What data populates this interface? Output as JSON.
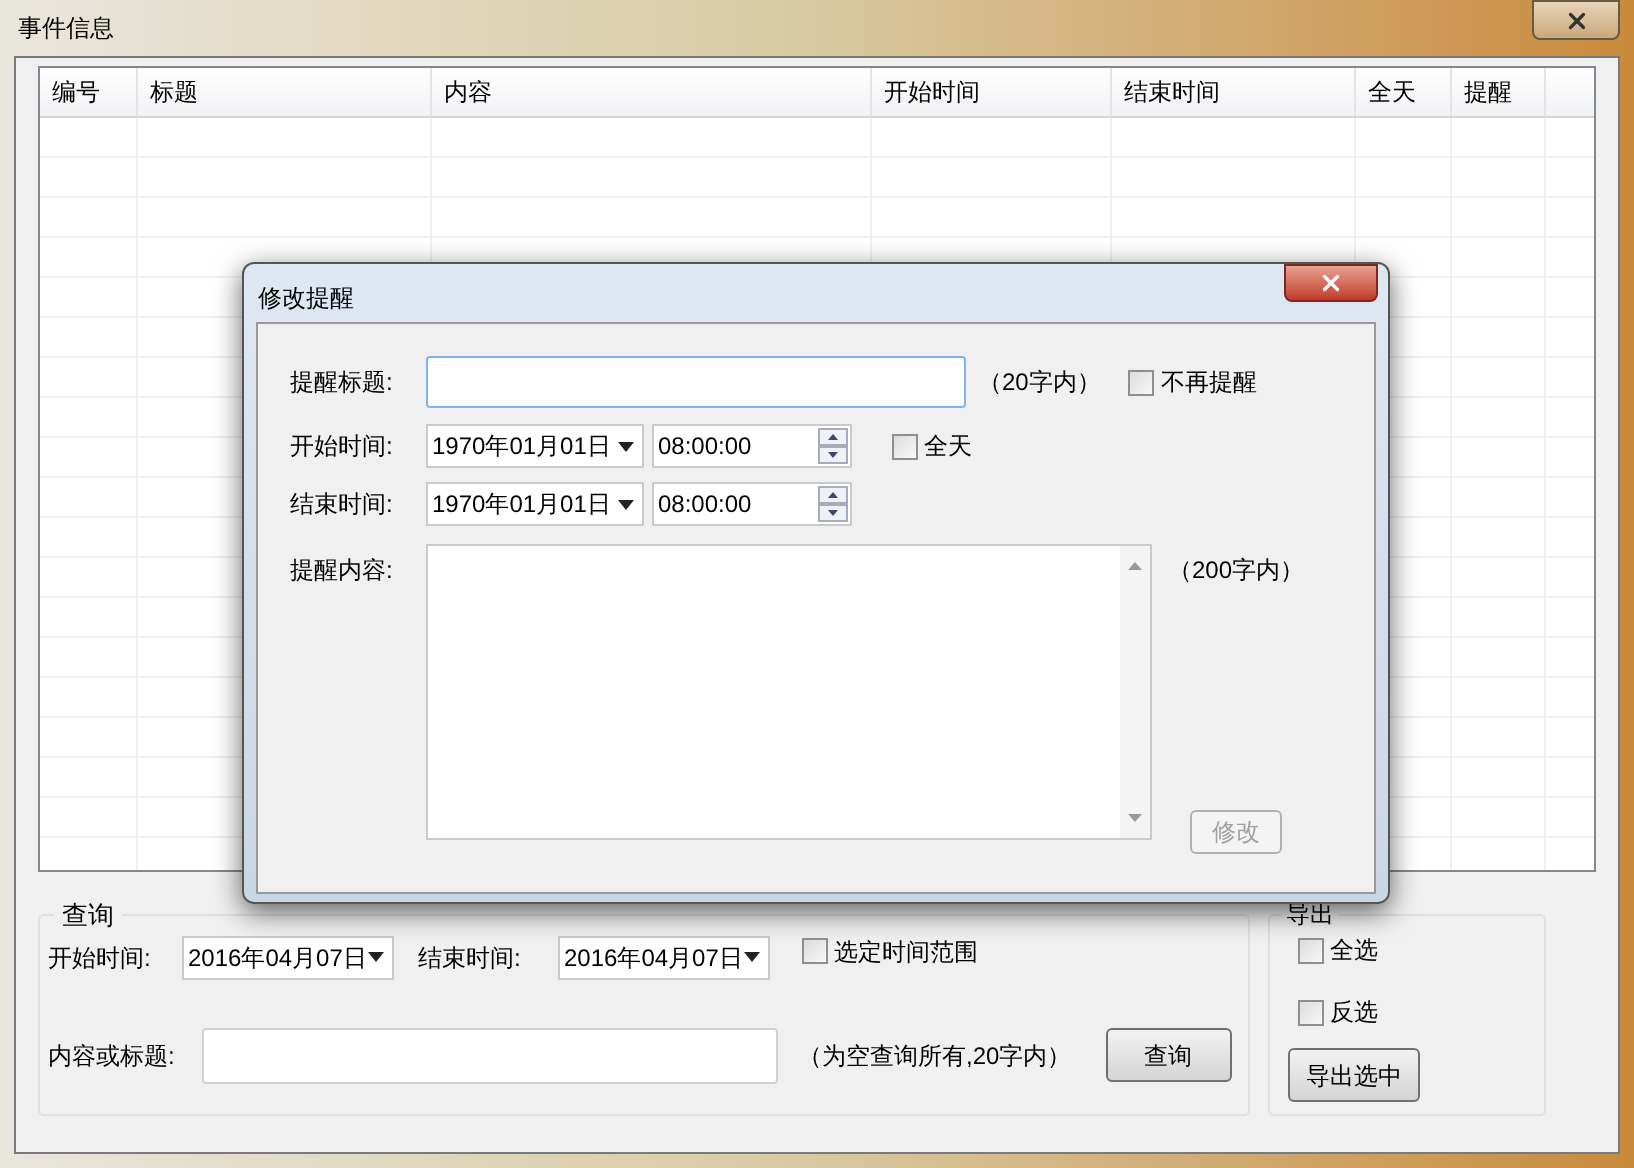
{
  "window": {
    "title": "事件信息"
  },
  "table": {
    "columns": [
      "编号",
      "标题",
      "内容",
      "开始时间",
      "结束时间",
      "全天",
      "提醒"
    ]
  },
  "dialog": {
    "title": "修改提醒",
    "title_label": "提醒标题:",
    "title_hint": "（20字内）",
    "no_remind": {
      "label": "不再提醒",
      "checked": false
    },
    "start_label": "开始时间:",
    "start_date": "1970年01月01日",
    "start_time": "08:00:00",
    "all_day": {
      "label": "全天",
      "checked": false
    },
    "end_label": "结束时间:",
    "end_date": "1970年01月01日",
    "end_time": "08:00:00",
    "content_label": "提醒内容:",
    "content_hint": "（200字内）",
    "submit": {
      "label": "修改",
      "disabled": true
    }
  },
  "query": {
    "title": "查询",
    "start_label": "开始时间:",
    "start_date": "2016年04月07日",
    "end_label": "结束时间:",
    "end_date": "2016年04月07日",
    "range": {
      "label": "选定时间范围",
      "checked": false
    },
    "keyword_label": "内容或标题:",
    "keyword_hint": "（为空查询所有,20字内）",
    "button": "查询"
  },
  "export": {
    "title": "导出",
    "select_all": {
      "label": "全选",
      "checked": false
    },
    "invert": {
      "label": "反选",
      "checked": false
    },
    "button": "导出选中"
  }
}
